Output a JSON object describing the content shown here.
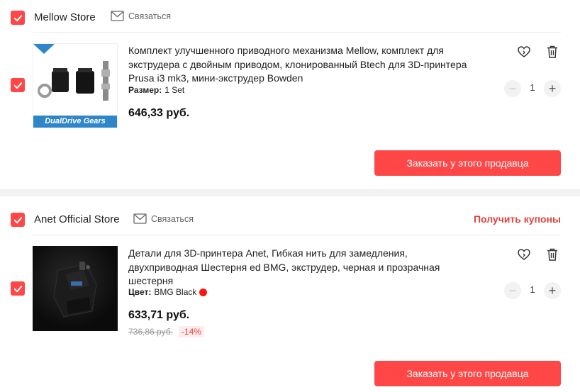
{
  "stores": [
    {
      "name": "Mellow Store",
      "contact_label": "Связаться",
      "coupons_label": "",
      "item": {
        "image_caption": "DualDrive Gears",
        "title": "Комплект улучшенного приводного механизма Mellow, комплект для экструдера с двойным приводом, клонированный Btech для 3D-принтера Prusa i3 mk3, мини-экструдер Bowden",
        "attr_label": "Размер:",
        "attr_value": "1 Set",
        "price": "646,33 руб.",
        "old_price": "",
        "discount": "",
        "quantity": "1"
      },
      "order_button": "Заказать у этого продавца"
    },
    {
      "name": "Anet Official Store",
      "contact_label": "Связаться",
      "coupons_label": "Получить купоны",
      "item": {
        "title": "Детали для 3D-принтера Anet, Гибкая нить для замедления, двухприводная Шестерня ed BMG, экструдер, черная и прозрачная шестерня",
        "attr_label": "Цвет:",
        "attr_value": "BMG Black",
        "attr_color": "#ff1212",
        "price": "633,71 руб.",
        "old_price": "736,86 руб.",
        "discount": "-14%",
        "quantity": "1"
      },
      "order_button": "Заказать у этого продавца"
    }
  ],
  "colors": {
    "accent": "#ff4747",
    "coupon_text": "#e0433d",
    "separator": "#f2f2f2"
  },
  "icons": [
    "check-icon",
    "envelope-icon",
    "wishlist-heart-icon",
    "trash-icon",
    "minus-icon",
    "plus-icon"
  ]
}
